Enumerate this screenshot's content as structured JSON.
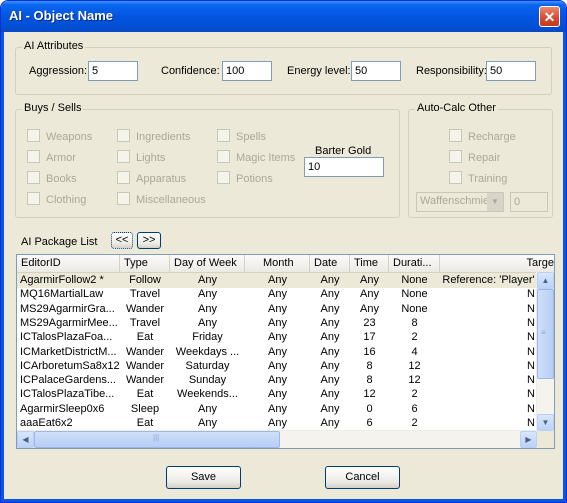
{
  "window": {
    "title": "AI - Object Name",
    "close_glyph": "✕"
  },
  "ai_attributes": {
    "group_label": "AI Attributes",
    "aggression_label": "Aggression:",
    "aggression_value": "5",
    "confidence_label": "Confidence:",
    "confidence_value": "100",
    "energy_label": "Energy level:",
    "energy_value": "50",
    "responsibility_label": "Responsibility:",
    "responsibility_value": "50"
  },
  "buys_sells": {
    "group_label": "Buys / Sells",
    "items": [
      "Weapons",
      "Armor",
      "Books",
      "Clothing",
      "Ingredients",
      "Lights",
      "Apparatus",
      "Miscellaneous",
      "Spells",
      "Magic Items",
      "Potions"
    ],
    "barter_label": "Barter Gold",
    "barter_value": "10"
  },
  "auto_calc": {
    "group_label": "Auto-Calc Other",
    "items": [
      "Recharge",
      "Repair",
      "Training"
    ],
    "skill_select": "Waffenschmie",
    "skill_value": "0"
  },
  "packages": {
    "label": "AI Package List",
    "prev_button": "<<",
    "next_button": ">>",
    "columns": [
      "EditorID",
      "Type",
      "Day of Week",
      "Month",
      "Date",
      "Time",
      "Durati...",
      "Targe"
    ],
    "rows": [
      [
        "AgarmirFollow2 *",
        "Follow",
        "Any",
        "Any",
        "Any",
        "Any",
        "None",
        "Reference: 'Player'"
      ],
      [
        "MQ16MartialLaw",
        "Travel",
        "Any",
        "Any",
        "Any",
        "Any",
        "None",
        "N"
      ],
      [
        "MS29AgarmirGra...",
        "Wander",
        "Any",
        "Any",
        "Any",
        "Any",
        "None",
        "N"
      ],
      [
        "MS29AgarmirMee...",
        "Travel",
        "Any",
        "Any",
        "Any",
        "23",
        "8",
        "N"
      ],
      [
        "ICTalosPlazaFoa...",
        "Eat",
        "Friday",
        "Any",
        "Any",
        "17",
        "2",
        "N"
      ],
      [
        "ICMarketDistrictM...",
        "Wander",
        "Weekdays ...",
        "Any",
        "Any",
        "16",
        "4",
        "N"
      ],
      [
        "ICArboretumSa8x12",
        "Wander",
        "Saturday",
        "Any",
        "Any",
        "8",
        "12",
        "N"
      ],
      [
        "ICPalaceGardens...",
        "Wander",
        "Sunday",
        "Any",
        "Any",
        "8",
        "12",
        "N"
      ],
      [
        "ICTalosPlazaTibe...",
        "Eat",
        "Weekends...",
        "Any",
        "Any",
        "12",
        "2",
        "N"
      ],
      [
        "AgarmirSleep0x6",
        "Sleep",
        "Any",
        "Any",
        "Any",
        "0",
        "6",
        "N"
      ],
      [
        "aaaEat6x2",
        "Eat",
        "Any",
        "Any",
        "Any",
        "6",
        "2",
        "N"
      ]
    ]
  },
  "buttons": {
    "save": "Save",
    "cancel": "Cancel"
  }
}
